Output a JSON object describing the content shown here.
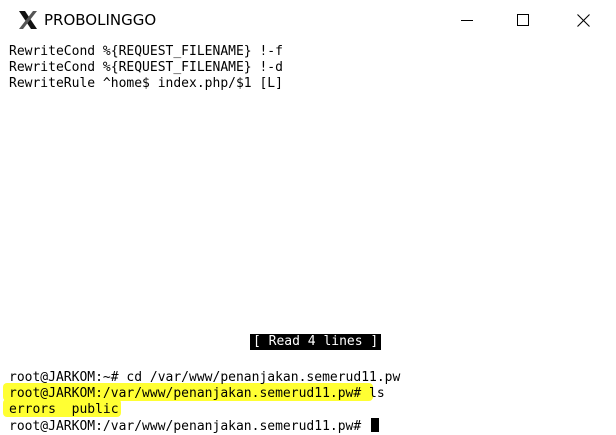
{
  "window": {
    "title": "PROBOLINGGO",
    "icon": "x-window-icon",
    "controls": {
      "minimize": "minimize-icon",
      "maximize": "maximize-icon",
      "close": "close-icon"
    }
  },
  "terminal": {
    "file_lines": [
      "RewriteCond %{REQUEST_FILENAME} !-f",
      "RewriteCond %{REQUEST_FILENAME} !-d",
      "RewriteRule ^home$ index.php/$1 [L]"
    ],
    "status_message": "[ Read 4 lines ]",
    "shell_lines": [
      "root@JARKOM:~# cd /var/www/penanjakan.semerud11.pw",
      "root@JARKOM:/var/www/penanjakan.semerud11.pw# ls",
      "errors  public",
      "root@JARKOM:/var/www/penanjakan.semerud11.pw#"
    ],
    "highlight_color": "#ffff33"
  }
}
